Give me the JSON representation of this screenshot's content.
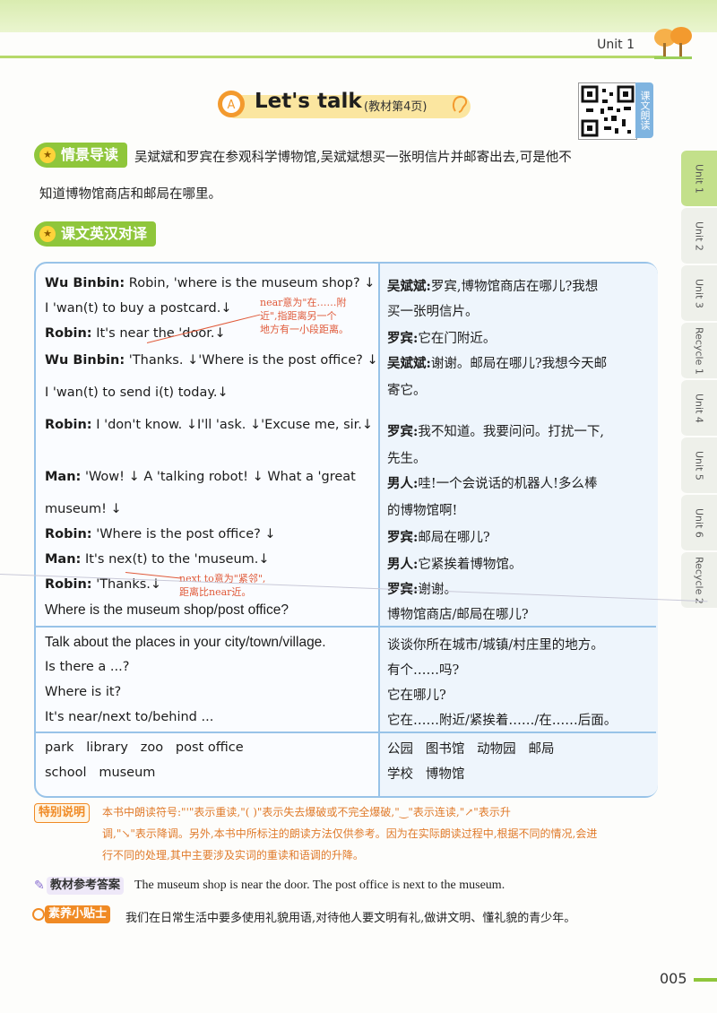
{
  "header": {
    "unit": "Unit 1"
  },
  "title": {
    "main": "Let's talk",
    "sub": "(教材第4页)"
  },
  "qr_label": "课文朗读",
  "side_tabs": [
    "Unit 1",
    "Unit 2",
    "Unit 3",
    "Recycle 1",
    "Unit 4",
    "Unit 5",
    "Unit 6",
    "Recycle 2"
  ],
  "sections": {
    "intro_title": "情景导读",
    "dialogue_title": "课文英汉对译"
  },
  "intro": {
    "line1": "吴斌斌和罗宾在参观科学博物馆,吴斌斌想买一张明信片并邮寄出去,可是他不",
    "line2": "知道博物馆商店和邮局在哪里。"
  },
  "dialogue": [
    {
      "speaker": "Wu Binbin:",
      "en": "Robin, 'where is the museum shop? ↓",
      "cn_speaker": "吴斌斌:",
      "cn": "罗宾,博物馆商店在哪儿?我想"
    },
    {
      "speaker": "",
      "en": "I 'wan(t) to buy a postcard.↓",
      "cn_speaker": "",
      "cn": "买一张明信片。"
    },
    {
      "speaker": "Robin:",
      "en": "It's near the 'door.↓",
      "cn_speaker": "罗宾:",
      "cn": "它在门附近。"
    },
    {
      "speaker": "Wu Binbin:",
      "en": "'Thanks. ↓'Where is the post office? ↓",
      "cn_speaker": "吴斌斌:",
      "cn": "谢谢。邮局在哪儿?我想今天邮"
    },
    {
      "speaker": "",
      "en": "I 'wan(t) to send i(t) today.↓",
      "cn_speaker": "",
      "cn": "寄它。"
    },
    {
      "speaker": "Robin:",
      "en": "I 'don't know. ↓I'll 'ask. ↓'Excuse me, sir.↓",
      "cn_speaker": "罗宾:",
      "cn": "我不知道。我要问问。打扰一下,"
    },
    {
      "speaker": "",
      "en": "",
      "cn_speaker": "",
      "cn": "先生。"
    },
    {
      "speaker": "Man:",
      "en": "'Wow! ↓ A 'talking robot! ↓ What a 'great",
      "cn_speaker": "男人:",
      "cn": "哇!一个会说话的机器人!多么棒"
    },
    {
      "speaker": "",
      "en": "museum! ↓",
      "cn_speaker": "",
      "cn": "的博物馆啊!"
    },
    {
      "speaker": "Robin:",
      "en": "'Where is the post office? ↓",
      "cn_speaker": "罗宾:",
      "cn": "邮局在哪儿?"
    },
    {
      "speaker": "Man:",
      "en": "It's nex(t) to the 'museum.↓",
      "cn_speaker": "男人:",
      "cn": "它紧挨着博物馆。"
    },
    {
      "speaker": "Robin:",
      "en": "'Thanks.↓",
      "cn_speaker": "罗宾:",
      "cn": "谢谢。"
    }
  ],
  "notes": {
    "near": [
      "near意为\"在……附",
      "近\",指距离另一个",
      "地方有一小段距离。"
    ],
    "next_to": [
      "next to意为\"紧邻\",",
      "距离比near近。"
    ]
  },
  "key_sentence": {
    "en": "Where is the museum shop/post office?",
    "cn": "博物馆商店/邮局在哪儿?"
  },
  "task": {
    "en": [
      "Talk about the places in your city/town/village.",
      "Is there a ...?",
      "Where is it?",
      "It's near/next to/behind ..."
    ],
    "cn": [
      "谈谈你所在城市/城镇/村庄里的地方。",
      "有个……吗?",
      "它在哪儿?",
      "它在……附近/紧挨着……/在……后面。"
    ]
  },
  "words": {
    "en": [
      "park   library   zoo   post office",
      "school   museum"
    ],
    "cn": [
      "公园   图书馆   动物园   邮局",
      "学校   博物馆"
    ]
  },
  "special_note": {
    "label": "特别说明",
    "lines": [
      "本书中朗读符号:\"'\"表示重读,\"( )\"表示失去爆破或不完全爆破,\"‿\"表示连读,\"↗\"表示升",
      "调,\"↘\"表示降调。另外,本书中所标注的朗读方法仅供参考。因为在实际朗读过程中,根据不同的情况,会进",
      "行不同的处理,其中主要涉及实词的重读和语调的升降。"
    ]
  },
  "answer": {
    "label": "教材参考答案",
    "text": "The museum shop is near the door. The post office is next to the museum."
  },
  "tip": {
    "label": "素养小贴士",
    "text": "我们在日常生活中要多使用礼貌用语,对待他人要文明有礼,做讲文明、懂礼貌的青少年。"
  },
  "page_number": "005",
  "colors": {
    "green": "#8fc63b",
    "blue_border": "#98c3e8",
    "note_red": "#e05a3a",
    "orange": "#f08a24"
  }
}
